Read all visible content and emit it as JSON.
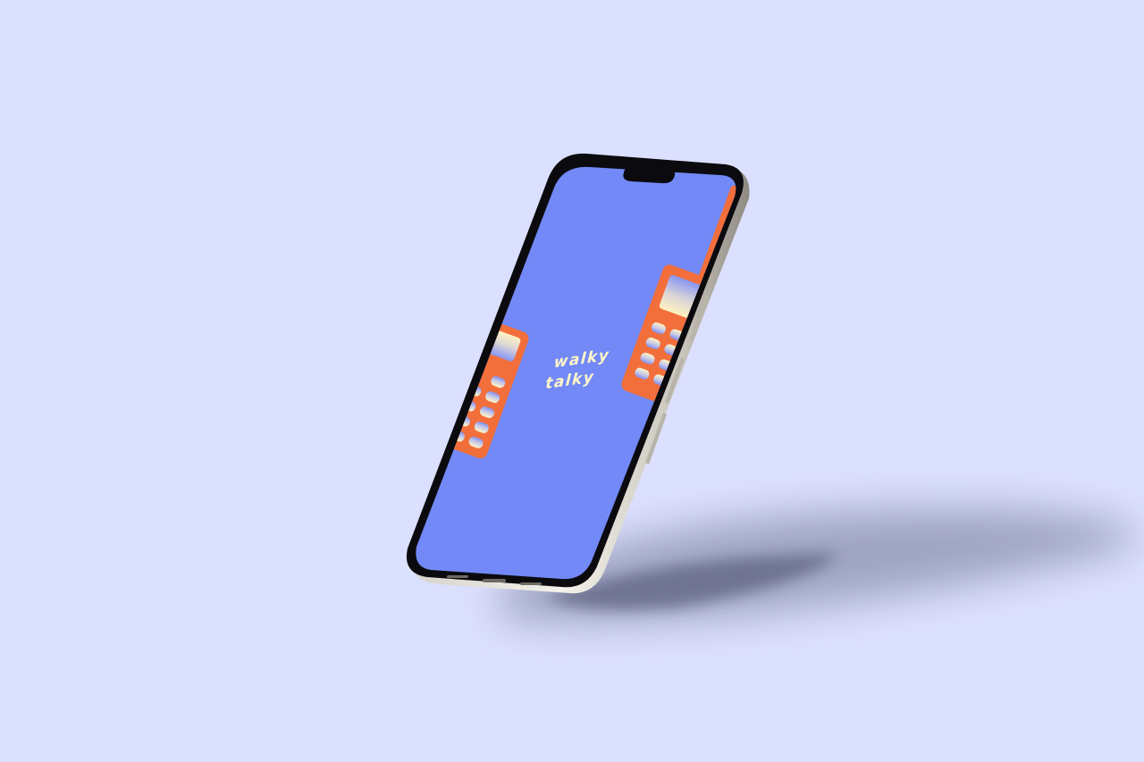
{
  "wordmark": {
    "line1": "walky",
    "line2": "talky"
  },
  "colors": {
    "background": "#dbe0fe",
    "screen": "#7289f7",
    "device_orange": "#f26f3b",
    "frame_light": "#eceae3",
    "frame_dark": "#a9a59c",
    "bezel": "#0b0b0f",
    "text_cream": "#fff6c8",
    "shadow": "#6f7594"
  },
  "icons": {
    "left_graphic": "walkie-talkie-icon",
    "right_graphic": "walkie-talkie-icon",
    "island": "dynamic-island-icon"
  }
}
